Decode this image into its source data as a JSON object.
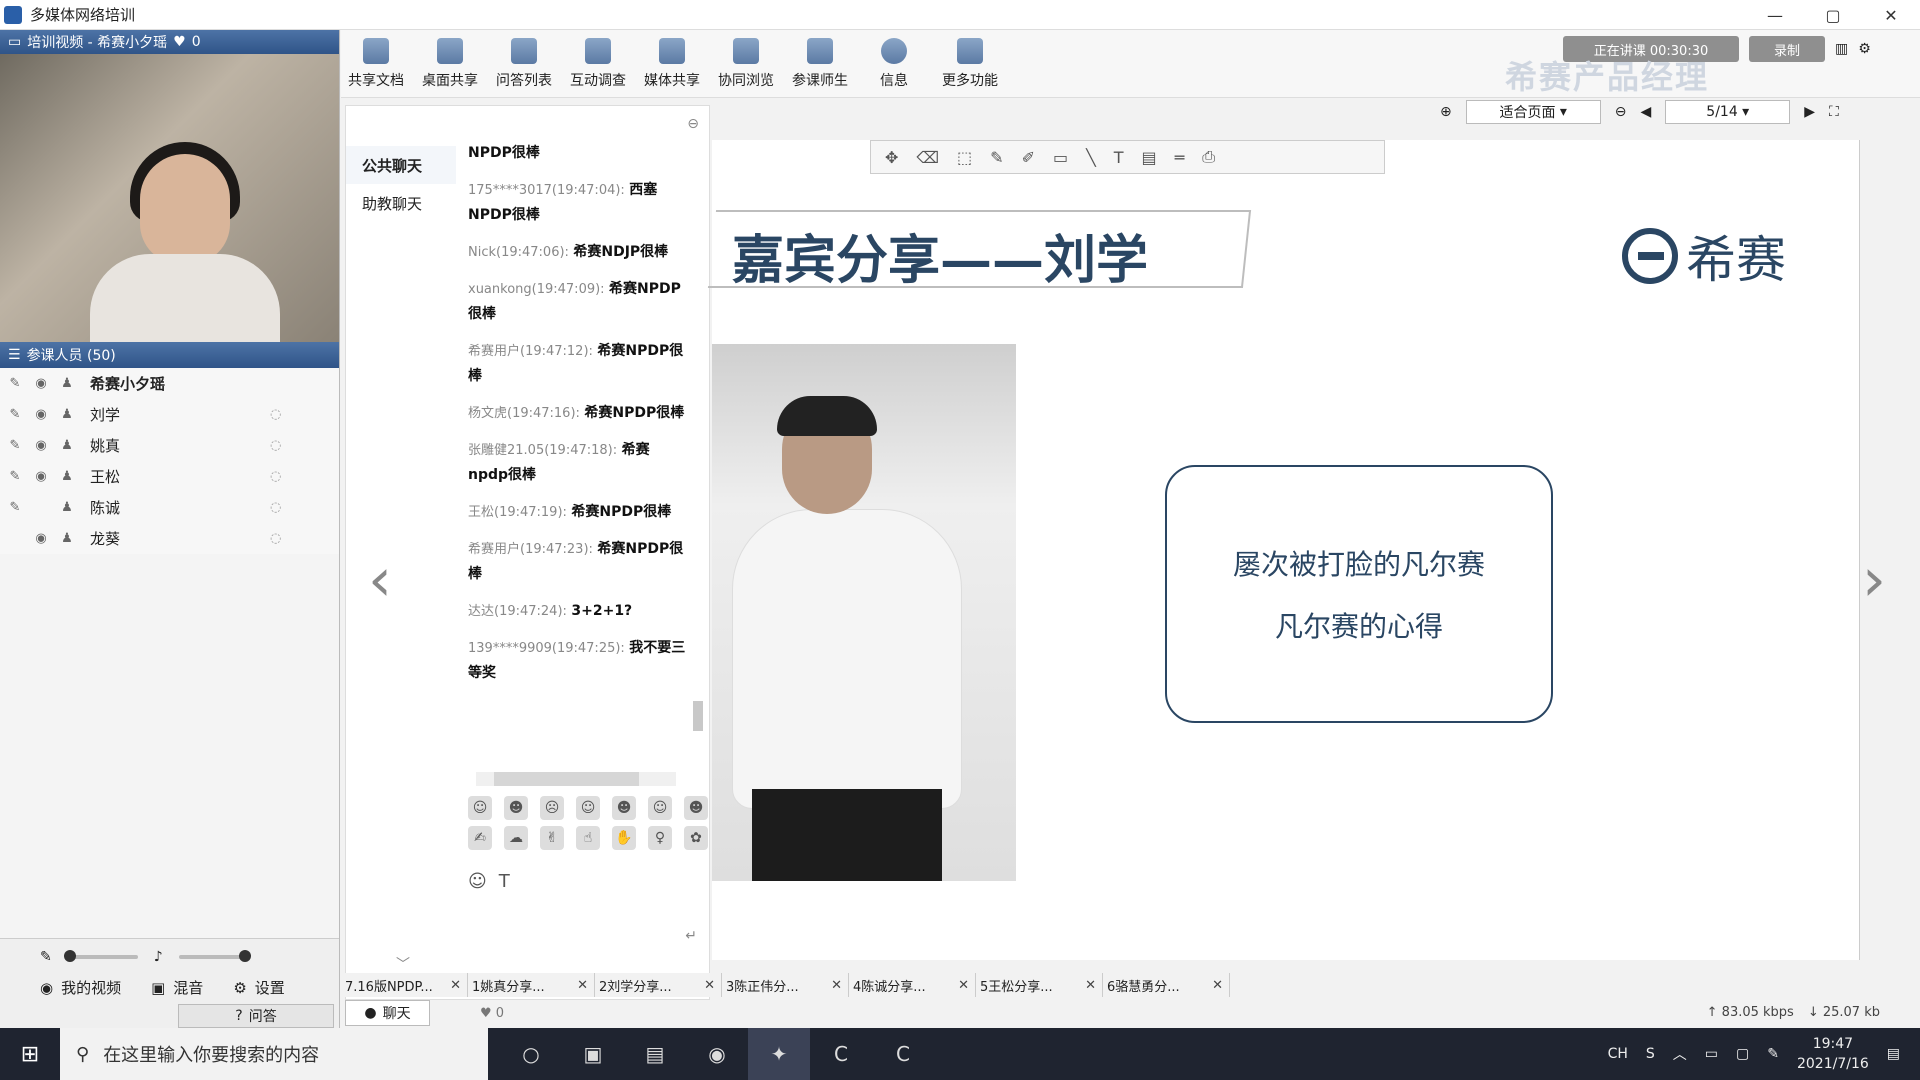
{
  "window": {
    "title": "多媒体网络培训"
  },
  "video": {
    "header": "培训视频 - 希赛小夕瑶",
    "likes": "0"
  },
  "members": {
    "header": "参课人员 (50)",
    "host": "希赛小夕瑶",
    "list": [
      {
        "name": "刘学"
      },
      {
        "name": "姚真"
      },
      {
        "name": "王松"
      },
      {
        "name": "陈诚"
      },
      {
        "name": "龙葵"
      }
    ]
  },
  "left_bottom": {
    "my_video": "我的视频",
    "mix": "混音",
    "settings": "设置",
    "qa": "问答"
  },
  "toolbar": {
    "items": [
      "共享文档",
      "桌面共享",
      "问答列表",
      "互动调查",
      "媒体共享",
      "协同浏览",
      "参课师生",
      "信息",
      "更多功能"
    ],
    "status": "正在讲课 00:30:30",
    "record": "录制"
  },
  "watermark": "希赛产品经理",
  "chat": {
    "nav": [
      "公共聊天",
      "助教聊天"
    ],
    "messages": [
      {
        "meta": "",
        "text": "NPDP很棒"
      },
      {
        "meta": "175****3017(19:47:04):",
        "text": "西塞NPDP很棒"
      },
      {
        "meta": "Nick(19:47:06):",
        "text": "希赛NDJP很棒"
      },
      {
        "meta": "xuankong(19:47:09):",
        "text": "希赛NPDP很棒"
      },
      {
        "meta": "希赛用户(19:47:12):",
        "text": "希赛NPDP很棒"
      },
      {
        "meta": "杨文虎(19:47:16):",
        "text": "希赛NPDP很棒"
      },
      {
        "meta": "张雕健21.05(19:47:18):",
        "text": "希赛npdp很棒"
      },
      {
        "meta": "王松(19:47:19):",
        "text": "希赛NPDP很棒"
      },
      {
        "meta": "希赛用户(19:47:23):",
        "text": "希赛NPDP很棒"
      },
      {
        "meta": "达达(19:47:24):",
        "text": "3+2+1?"
      },
      {
        "meta": "139****9909(19:47:25):",
        "text": "我不要三等奖"
      }
    ],
    "tab": "聊天",
    "likes": "0"
  },
  "viewer": {
    "fit": "适合页面",
    "page": "5/14"
  },
  "slide": {
    "title": "嘉宾分享——刘学",
    "logo": "希赛",
    "lines": [
      "屡次被打脸的凡尔赛",
      "凡尔赛的心得"
    ]
  },
  "doc_tabs": [
    "7.16版NPDP...",
    "1姚真分享...",
    "2刘学分享...",
    "3陈正伟分...",
    "4陈诚分享...",
    "5王松分享...",
    "6骆慧勇分..."
  ],
  "net": {
    "up": "83.05 kbps",
    "down": "25.07 kb"
  },
  "taskbar": {
    "search_placeholder": "在这里输入你要搜索的内容",
    "ime": "CH",
    "time": "19:47",
    "date": "2021/7/16"
  }
}
